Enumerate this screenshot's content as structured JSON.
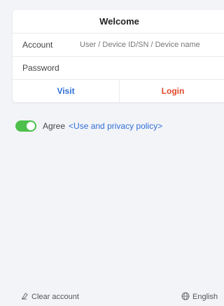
{
  "login_card": {
    "title": "Welcome",
    "account_label": "Account",
    "account_placeholder": "User / Device ID/SN / Device name",
    "password_label": "Password",
    "password_value": "",
    "visit_label": "Visit",
    "login_label": "Login"
  },
  "agreement": {
    "toggle_on": true,
    "toggle_color": "#4cc04a",
    "agree_text": "Agree",
    "policy_link": "<Use and privacy policy>"
  },
  "footer": {
    "clear_account_label": "Clear account",
    "clear_icon": "eraser-icon",
    "language_label": "English",
    "language_icon": "globe-icon"
  },
  "colors": {
    "link_blue": "#2f6fd6",
    "login_red": "#e2482c",
    "background": "#f3f4f8"
  }
}
